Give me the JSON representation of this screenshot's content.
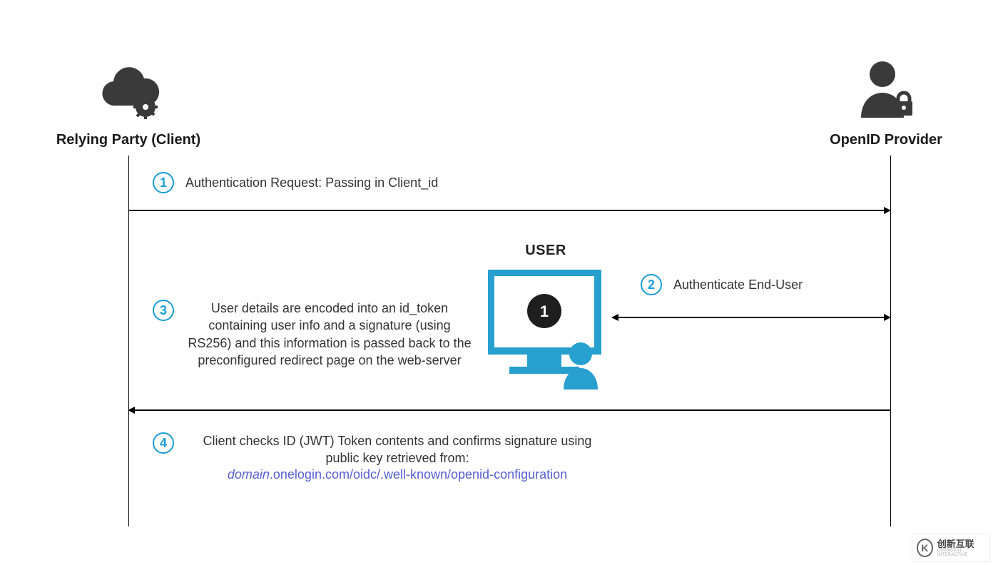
{
  "actors": {
    "left": "Relying Party (Client)",
    "right": "OpenID Provider"
  },
  "user_label": "USER",
  "steps": {
    "s1": {
      "num": "1",
      "text": "Authentication Request: Passing in Client_id"
    },
    "s2": {
      "num": "2",
      "text": "Authenticate End-User"
    },
    "s3": {
      "num": "3",
      "text": "User details are encoded into an id_token containing user info and a signature (using RS256) and this information is passed back to the preconfigured redirect page on the web-server"
    },
    "s4": {
      "num": "4",
      "text": "Client checks ID (JWT) Token contents and confirms signature using public key retrieved from:",
      "link_prefix": "domain",
      "link_rest": ".onelogin.com/oidc/.well-known/openid-configuration"
    }
  },
  "watermark": {
    "cn": "创新互联",
    "en": "CHANGXIN INTERACTIVE"
  }
}
